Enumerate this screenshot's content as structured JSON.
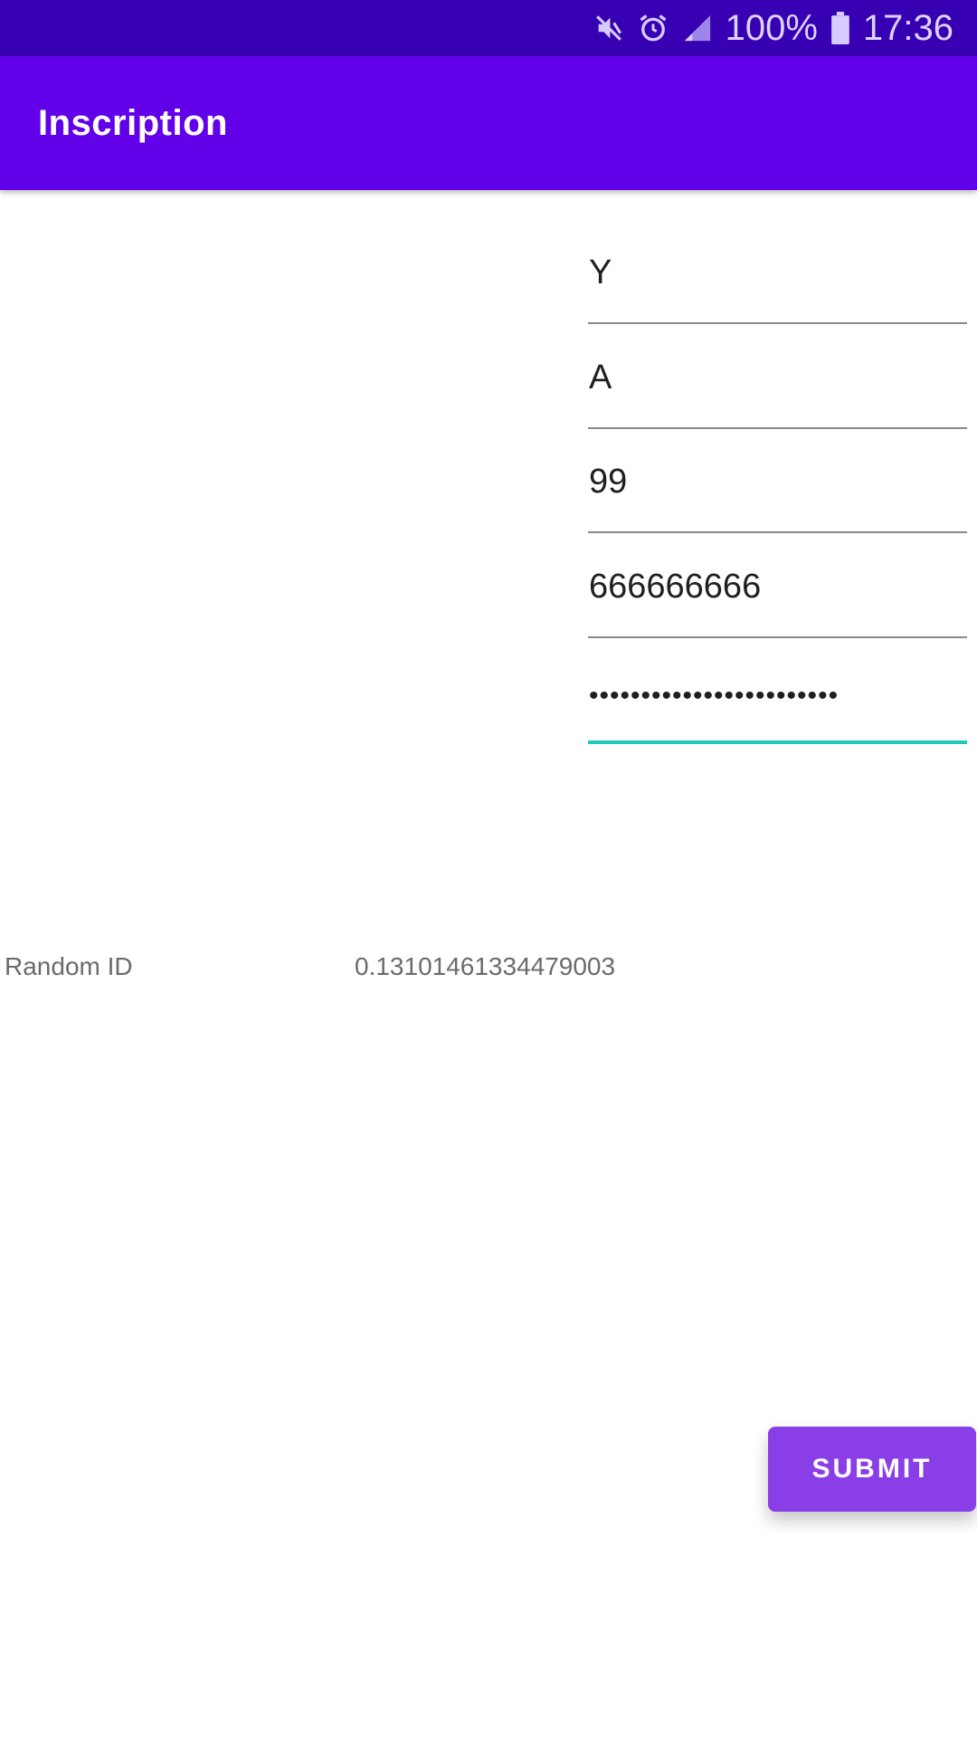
{
  "status_bar": {
    "icons": [
      "mute-icon",
      "alarm-icon",
      "signal-icon",
      "battery-icon"
    ],
    "battery": "100%",
    "time": "17:36"
  },
  "app_bar": {
    "title": "Inscription",
    "color": "#6200ea"
  },
  "form": {
    "fields": [
      {
        "value": "Y"
      },
      {
        "value": "A"
      },
      {
        "value": "99"
      },
      {
        "value": "666666666"
      },
      {
        "value": "••••••••••••••••••••••••",
        "focused": true
      }
    ],
    "focus_color": "#20c9b8"
  },
  "random_id": {
    "label": "Random ID",
    "value": "0.13101461334479003"
  },
  "submit": {
    "label": "SUBMIT",
    "color": "#8a3ee8"
  }
}
